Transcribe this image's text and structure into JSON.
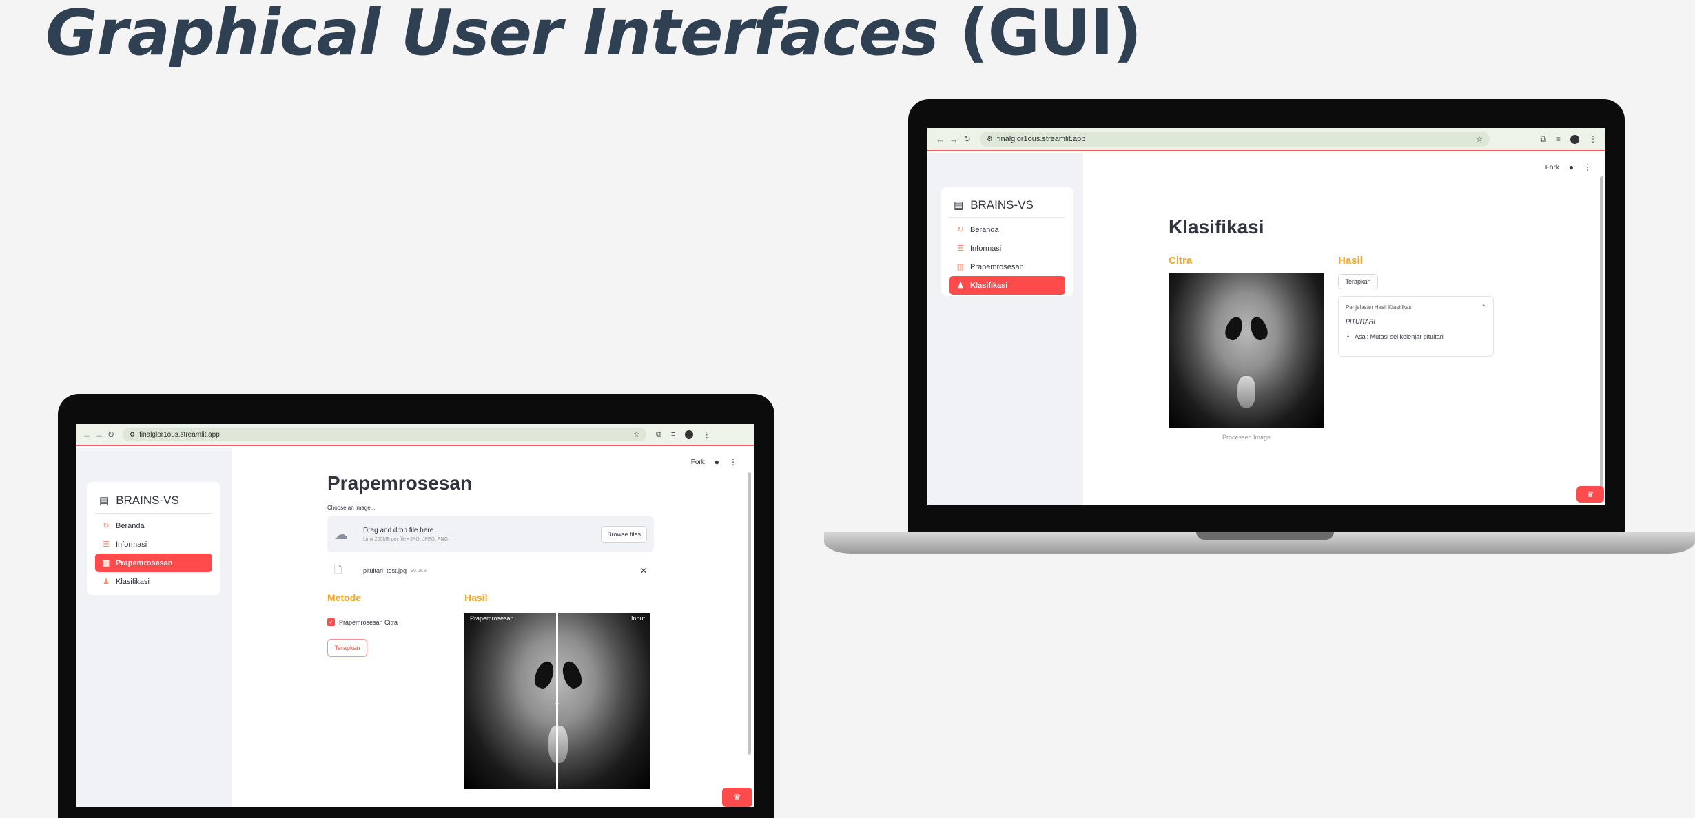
{
  "slide": {
    "title_italic": "Graphical User Interfaces",
    "title_rest": "(GUI)"
  },
  "browser": {
    "url": "finalglor1ous.streamlit.app"
  },
  "app": {
    "brand": "BRAINS-VS",
    "menu": [
      "Beranda",
      "Informasi",
      "Prapemrosesan",
      "Klasifikasi"
    ],
    "topbar": {
      "fork": "Fork"
    }
  },
  "left_screen": {
    "page_title": "Prapemrosesan",
    "uploader_label": "Choose an image...",
    "dropzone_title": "Drag and drop file here",
    "dropzone_hint": "Limit 200MB per file • JPG, JPEG, PNG",
    "browse_button": "Browse files",
    "file_name": "pituitari_test.jpg",
    "file_size": "20.0KB",
    "metode_heading": "Metode",
    "hasil_heading": "Hasil",
    "checkbox_label": "Prapemrosesan Citra",
    "apply_button": "Terapkan",
    "compare_left_label": "Prapemrosesan",
    "compare_right_label": "Input"
  },
  "right_screen": {
    "page_title": "Klasifikasi",
    "citra_heading": "Citra",
    "hasil_heading": "Hasil",
    "apply_button": "Terapkan",
    "image_caption": "Processed Image",
    "expander_title": "Penjelasan Hasil Klasifikasi",
    "result_class": "PITUITARI",
    "result_detail": "Asal: Mutasi sel kelenjar pituitari"
  },
  "colors": {
    "accent": "#ff4b4b",
    "heading_orange": "#f5a623",
    "slide_title": "#2f4052"
  }
}
